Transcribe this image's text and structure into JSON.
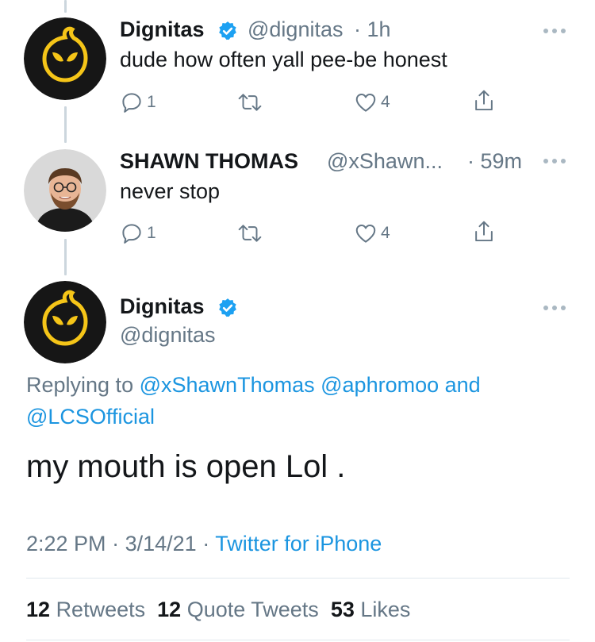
{
  "tweets": [
    {
      "name": "Dignitas",
      "handle": "@dignitas",
      "time": "· 1h",
      "text": "dude how often yall pee-be honest",
      "replies": "1",
      "likes": "4"
    },
    {
      "name": "SHAWN THOMAS",
      "handle": "@xShawn...",
      "time": "· 59m",
      "text": "never stop",
      "replies": "1",
      "likes": "4"
    }
  ],
  "main": {
    "name": "Dignitas",
    "handle": "@dignitas",
    "replying_prefix": "Replying to",
    "mention_1": "@xShawnThomas",
    "mention_2": "@aphromoo",
    "conjunction": "and",
    "mention_3": "@LCSOfficial",
    "text": "my mouth is open Lol .",
    "time": "2:22 PM",
    "date": "3/14/21",
    "separator": "·",
    "source": "Twitter for iPhone",
    "retweets_count": "12",
    "retweets_label": "Retweets",
    "quotes_count": "12",
    "quotes_label": "Quote Tweets",
    "likes_count": "53",
    "likes_label": "Likes"
  },
  "colors": {
    "link": "#1b95e0",
    "secondary_text": "#657786",
    "verified": "#1da1f2",
    "dignitas_yellow": "#f5c518",
    "thread_line": "#ccd6dd"
  },
  "icons": [
    "reply-icon",
    "retweet-icon",
    "like-icon",
    "share-icon",
    "verified-badge-icon",
    "more-icon"
  ]
}
